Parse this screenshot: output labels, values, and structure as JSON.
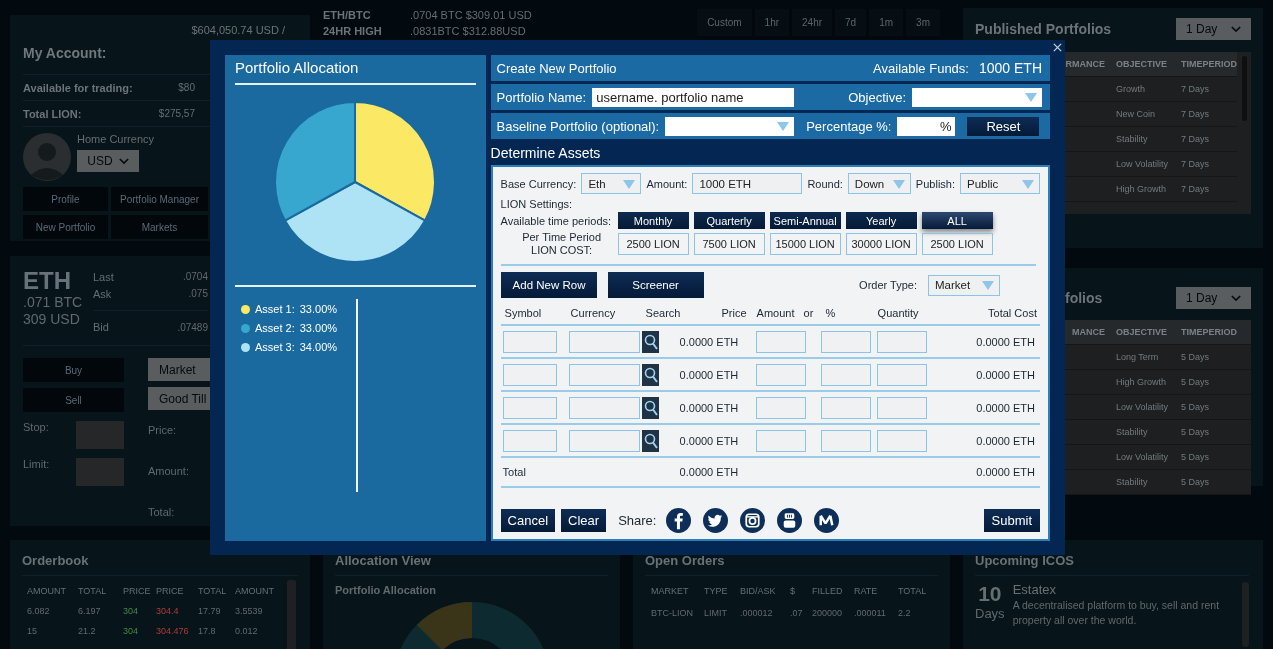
{
  "account": {
    "title": "My Account:",
    "balance": "$604,050.74 USD /",
    "rows": [
      {
        "label": "Available for trading:",
        "value": "$80"
      },
      {
        "label": "Total LION:",
        "value": "$275,57"
      }
    ],
    "home_currency_label": "Home Currency",
    "currency": "USD",
    "buttons": [
      "Profile",
      "Portfolio Manager",
      "New Portfolio",
      "Markets"
    ]
  },
  "ticker": {
    "rows": [
      {
        "label": "ETH/BTC",
        "value": ".0704 BTC $309.01 USD"
      },
      {
        "label": "24HR HIGH",
        "value": ".0831BTC $312.88USD"
      }
    ],
    "ranges": [
      "Custom",
      "1hr",
      "24hr",
      "7d",
      "1m",
      "3m"
    ]
  },
  "trade": {
    "coin": "ETH",
    "btc": ".071 BTC",
    "usd": "309 USD",
    "quotes": [
      {
        "label": "Last",
        "value": ".0704"
      },
      {
        "label": "Ask",
        "value": ".075"
      },
      {
        "label": "Bid",
        "value": ".07489"
      }
    ],
    "buy": "Buy",
    "sell": "Sell",
    "stop_label": "Stop:",
    "limit_label": "Limit:",
    "order_options": [
      "Market",
      "Good Till"
    ],
    "price_label": "Price:",
    "amount_label": "Amount:",
    "total_label": "Total:"
  },
  "published": [
    {
      "title": "Published Portfolios",
      "period": "1 Day",
      "columns": [
        "RMANCE",
        "OBJECTIVE",
        "TIMEPERIOD"
      ],
      "rows": [
        [
          "",
          "Growth",
          "7 Days"
        ],
        [
          "",
          "New Coin",
          "7 Days"
        ],
        [
          "",
          "Stability",
          "7 Days"
        ],
        [
          "",
          "Low Volatility",
          "7 Days"
        ],
        [
          "",
          "High Growth",
          "7 Days"
        ]
      ]
    },
    {
      "title": "folios",
      "period": "1 Day",
      "columns": [
        "MANCE",
        "OBJECTIVE",
        "TIMEPERIOD"
      ],
      "rows": [
        [
          "",
          "Long Term",
          "5 Days"
        ],
        [
          "",
          "High Growth",
          "5 Days"
        ],
        [
          "",
          "Low Volatility",
          "5 Days"
        ],
        [
          "",
          "Stability",
          "5 Days"
        ],
        [
          "",
          "Low Volatility",
          "5 Days"
        ],
        [
          "",
          "Stability",
          "5 Days"
        ]
      ]
    }
  ],
  "orderbook": {
    "title": "Orderbook",
    "columns": [
      "AMOUNT",
      "TOTAL",
      "PRICE",
      "PRICE",
      "TOTAL",
      "AMOUNT"
    ],
    "rows": [
      [
        "6.082",
        "6.197",
        "304",
        "304.4",
        "17.79",
        "3.5539"
      ],
      [
        "15",
        "21.2",
        "304",
        "304.476",
        "17.8",
        "0.012"
      ]
    ]
  },
  "allocation_view": {
    "title": "Allocation View",
    "subtitle": "Portfolio Allocation"
  },
  "open_orders": {
    "title": "Open Orders",
    "columns": [
      "MARKET",
      "TYPE",
      "BID/ASK",
      "$",
      "FILLED",
      "RATE",
      "TOTAL"
    ],
    "rows": [
      [
        "BTC-LION",
        "LIMIT",
        ".000012",
        ".07",
        "200000",
        ".000011",
        "2.2"
      ]
    ]
  },
  "upcoming_icos": {
    "title": "Upcoming ICOS",
    "items": [
      {
        "days": "10",
        "days_label": "Days",
        "name": "Estatex",
        "description": "A decentralised platform to buy, sell and rent property all over the world."
      }
    ]
  },
  "modal": {
    "allocation": {
      "title": "Portfolio Allocation",
      "chart_data": {
        "type": "pie",
        "series": [
          {
            "values": [
              33,
              33,
              34
            ]
          }
        ]
      },
      "legend": [
        {
          "label": "Asset 1:",
          "value": "33.00%",
          "color": "#fbe865"
        },
        {
          "label": "Asset 2:",
          "value": "33.00%",
          "color": "#37a7d0"
        },
        {
          "label": "Asset 3:",
          "value": "34.00%",
          "color": "#aee2f5"
        }
      ]
    },
    "header": {
      "title": "Create New Portfolio",
      "funds_label": "Available Funds:",
      "funds": "1000 ETH"
    },
    "name_label": "Portfolio Name:",
    "name_value": "username. portfolio name",
    "objective_label": "Objective:",
    "baseline_label": "Baseline Portfolio (optional):",
    "percentage_label": "Percentage %:",
    "percent_suffix": "%",
    "reset": "Reset",
    "assets": {
      "title": "Determine Assets",
      "fields": [
        {
          "label": "Base Currency:",
          "value": "Eth",
          "kind": "select"
        },
        {
          "label": "Amount:",
          "value": "1000 ETH",
          "kind": "input"
        },
        {
          "label": "Round:",
          "value": "Down",
          "kind": "select"
        },
        {
          "label": "Publish:",
          "value": "Public",
          "kind": "select"
        }
      ],
      "lion_label": "LION Settings:",
      "periods_label": "Available time periods:",
      "periods": [
        {
          "label": "Monthly",
          "selected": false
        },
        {
          "label": "Quarterly",
          "selected": false
        },
        {
          "label": "Semi-Annual",
          "selected": false
        },
        {
          "label": "Yearly",
          "selected": false
        },
        {
          "label": "ALL",
          "selected": true
        }
      ],
      "cost_label": "Per Time Period LION COST:",
      "costs": [
        "2500 LION",
        "7500 LION",
        "15000 LION",
        "30000 LION",
        "2500 LION"
      ],
      "add_row": "Add New Row",
      "screener": "Screener",
      "order_type_label": "Order Type:",
      "order_type": "Market",
      "columns": [
        "Symbol",
        "Currency",
        "Search",
        "Price",
        "Amount",
        "or",
        "%",
        "Quantity",
        "Total Cost"
      ],
      "rows": [
        {
          "price": "0.0000 ETH",
          "total": "0.0000 ETH"
        },
        {
          "price": "0.0000 ETH",
          "total": "0.0000 ETH"
        },
        {
          "price": "0.0000 ETH",
          "total": "0.0000 ETH"
        },
        {
          "price": "0.0000 ETH",
          "total": "0.0000 ETH"
        }
      ],
      "total_row": {
        "label": "Total",
        "price": "0.0000 ETH",
        "total": "0.0000 ETH"
      }
    },
    "footer": {
      "cancel": "Cancel",
      "clear": "Clear",
      "share_label": "Share:",
      "submit": "Submit"
    }
  }
}
